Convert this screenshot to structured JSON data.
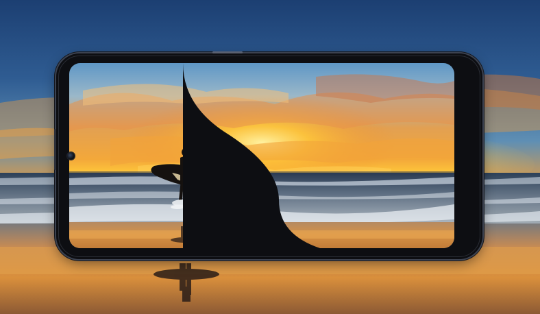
{
  "image": {
    "subject": "smartphone-with-surfer-sunset-wallpaper",
    "colors": {
      "sky_top": "#1c3f72",
      "sky_mid": "#4f88b8",
      "horizon_glow": "#f7b21e",
      "sunset_orange": "#ee8a2a",
      "sea": "#1f3550",
      "foam": "#c9d6e4",
      "wet_sand": "#c98a4a",
      "phone_body": "#0d0e12",
      "phone_rim": "#3c4250"
    }
  }
}
